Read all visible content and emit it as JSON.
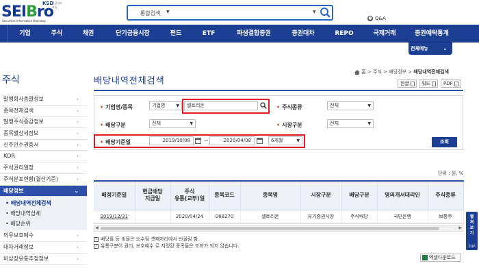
{
  "header": {
    "logo_main": "SEIBro",
    "logo_ksd": "KSD",
    "logo_sub": "증권정보포털",
    "logo_tag": "Securities Information Brainway",
    "search": {
      "category": "통합검색",
      "placeholder": ""
    },
    "qna": "Q&A"
  },
  "nav": [
    "기업",
    "주식",
    "채권",
    "단기금융시장",
    "펀드",
    "ETF",
    "파생결합증권",
    "증권대차",
    "REPO",
    "국제거래",
    "증권예탁통계"
  ],
  "all_menu": "전체메뉴",
  "sidebar": {
    "title": "주식",
    "items": [
      "발행회사총괄정보",
      "종목전체검색",
      "발행주식증감정보",
      "종목별상세정보",
      "신주인수권증서",
      "KDR",
      "주식권리일정",
      "주식분포현황(결산기준)"
    ],
    "active": "배당정보",
    "sub_items": [
      "• 배당내역전체검색",
      "• 배당내역상세",
      "• 배당순위"
    ],
    "after_items": [
      "의무보호예수",
      "대차거래정보",
      "비상장유통추정정보"
    ]
  },
  "main": {
    "page_title": "배당내역전체검색",
    "breadcrumb": {
      "home": "홈",
      "sep": ">",
      "level1": "주식",
      "level2": "배당정보",
      "current": "배당내역전체검색"
    },
    "util": {
      "hangul": "한글",
      "word": "워드",
      "pdf": "PDF"
    },
    "form": {
      "company_label": "기업명/종목",
      "company_type": "기업명",
      "company_value": "셀트리온",
      "stock_kind_label": "주식종류",
      "stock_kind_value": "전체",
      "div_type_label": "배당구분",
      "div_type_value": "전체",
      "market_label": "시장구분",
      "market_value": "전체",
      "date_label": "배당기준일",
      "date_from": "2019/10/08",
      "tilde": "~",
      "date_to": "2020/04/08",
      "period": "6개월",
      "submit": "조회"
    },
    "unit": "단위 : 원, %",
    "table": {
      "headers": [
        "배정기준일",
        "현금배당\n지급일",
        "주식\n유통(교부)일",
        "종목코드",
        "종목명",
        "시장구분",
        "배당구분",
        "명의개서대리인",
        "주식종류"
      ],
      "rows": [
        [
          "2019/12/31",
          "",
          "2020/04/24",
          "068270",
          "셀트리온",
          "유가증권시장",
          "주식배당",
          "국민은행",
          "보통주"
        ]
      ]
    },
    "notes": [
      "배당률 등 비율은 소수점 셋째자리에서 반올림 함.",
      "유통구분이 권리, 보호예수 로 지정된 종목들은 조회가 되지 않습니다."
    ],
    "excel_button": "엑셀다운로드"
  },
  "floating": {
    "label": "펼쳐보기",
    "top": "TOP"
  },
  "colors": {
    "brand_blue": "#1c3f94",
    "highlight_red": "#e11b25",
    "logo_green": "#2e9d3a"
  }
}
